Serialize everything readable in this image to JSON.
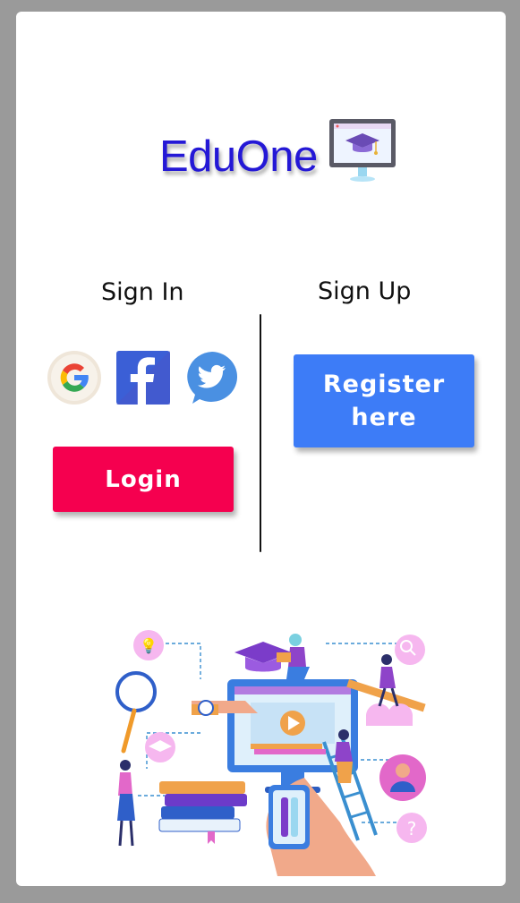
{
  "app": {
    "logo_text": "EduOne",
    "logo_icon": "graduation-monitor-icon"
  },
  "sign_in": {
    "title": "Sign In",
    "social": [
      {
        "name": "google",
        "icon": "google-icon"
      },
      {
        "name": "facebook",
        "icon": "facebook-icon"
      },
      {
        "name": "twitter",
        "icon": "twitter-icon"
      }
    ],
    "login_label": "Login"
  },
  "sign_up": {
    "title": "Sign Up",
    "register_label": "Register\nhere"
  },
  "colors": {
    "logo": "#2418d6",
    "login": "#f5004f",
    "register": "#3d7cf7",
    "backdrop": "#9a9a9a"
  },
  "illustration": "e-learning-illustration"
}
